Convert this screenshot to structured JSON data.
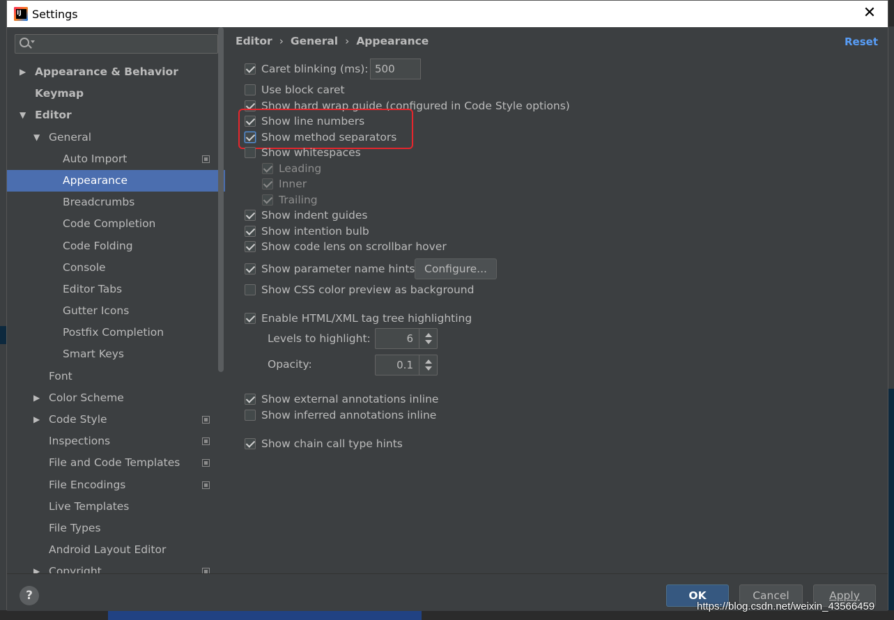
{
  "window": {
    "title": "Settings"
  },
  "search": {
    "placeholder": ""
  },
  "tree": [
    {
      "label": "Appearance & Behavior",
      "level": 0,
      "arrow": "▶",
      "bold": true
    },
    {
      "label": "Keymap",
      "level": 0,
      "arrow": "",
      "bold": true
    },
    {
      "label": "Editor",
      "level": 0,
      "arrow": "▼",
      "bold": true
    },
    {
      "label": "General",
      "level": 1,
      "arrow": "▼"
    },
    {
      "label": "Auto Import",
      "level": 2,
      "icon": true
    },
    {
      "label": "Appearance",
      "level": 2,
      "selected": true
    },
    {
      "label": "Breadcrumbs",
      "level": 2
    },
    {
      "label": "Code Completion",
      "level": 2
    },
    {
      "label": "Code Folding",
      "level": 2
    },
    {
      "label": "Console",
      "level": 2
    },
    {
      "label": "Editor Tabs",
      "level": 2
    },
    {
      "label": "Gutter Icons",
      "level": 2
    },
    {
      "label": "Postfix Completion",
      "level": 2
    },
    {
      "label": "Smart Keys",
      "level": 2
    },
    {
      "label": "Font",
      "level": 1
    },
    {
      "label": "Color Scheme",
      "level": 1,
      "arrow": "▶"
    },
    {
      "label": "Code Style",
      "level": 1,
      "arrow": "▶",
      "icon": true
    },
    {
      "label": "Inspections",
      "level": 1,
      "icon": true
    },
    {
      "label": "File and Code Templates",
      "level": 1,
      "icon": true
    },
    {
      "label": "File Encodings",
      "level": 1,
      "icon": true
    },
    {
      "label": "Live Templates",
      "level": 1
    },
    {
      "label": "File Types",
      "level": 1
    },
    {
      "label": "Android Layout Editor",
      "level": 1
    },
    {
      "label": "Copyright",
      "level": 1,
      "arrow": "▶",
      "icon": true
    }
  ],
  "breadcrumb": [
    "Editor",
    "General",
    "Appearance"
  ],
  "breadcrumb_sep": "›",
  "reset_label": "Reset",
  "options": {
    "caret_blinking": {
      "label": "Caret blinking (ms):",
      "checked": true,
      "value": "500"
    },
    "block_caret": {
      "label": "Use block caret",
      "checked": false
    },
    "hard_wrap": {
      "label": "Show hard wrap guide (configured in Code Style options)",
      "checked": true
    },
    "line_numbers": {
      "label": "Show line numbers",
      "checked": true
    },
    "method_separators": {
      "label": "Show method separators",
      "checked": true
    },
    "whitespaces": {
      "label": "Show whitespaces",
      "checked": false
    },
    "leading": {
      "label": "Leading",
      "checked": true
    },
    "inner": {
      "label": "Inner",
      "checked": true
    },
    "trailing": {
      "label": "Trailing",
      "checked": true
    },
    "indent_guides": {
      "label": "Show indent guides",
      "checked": true
    },
    "intention_bulb": {
      "label": "Show intention bulb",
      "checked": true
    },
    "code_lens": {
      "label": "Show code lens on scrollbar hover",
      "checked": true
    },
    "param_hints": {
      "label": "Show parameter name hints",
      "checked": true,
      "button": "Configure..."
    },
    "css_preview": {
      "label": "Show CSS color preview as background",
      "checked": false
    },
    "tag_tree": {
      "label": "Enable HTML/XML tag tree highlighting",
      "checked": true
    },
    "levels": {
      "label": "Levels to highlight:",
      "value": "6"
    },
    "opacity": {
      "label": "Opacity:",
      "value": "0.1"
    },
    "ext_annotations": {
      "label": "Show external annotations inline",
      "checked": true
    },
    "inferred_annotations": {
      "label": "Show inferred annotations inline",
      "checked": false
    },
    "chain_hints": {
      "label": "Show chain call type hints",
      "checked": true
    }
  },
  "buttons": {
    "help": "?",
    "ok": "OK",
    "cancel": "Cancel",
    "apply": "Apply"
  },
  "watermark": "https://blog.csdn.net/weixin_43566459",
  "colors": {
    "selection": "#4b6eaf",
    "link": "#589df6",
    "highlight_box": "#e5262d",
    "ok_button": "#365880"
  }
}
